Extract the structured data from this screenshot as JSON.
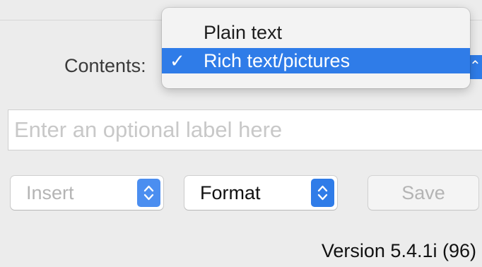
{
  "contents": {
    "label": "Contents:",
    "menu": {
      "options": [
        "Plain text",
        "Rich text/pictures"
      ],
      "selected_index": 1,
      "check_mark": "✓"
    }
  },
  "label_field": {
    "placeholder": "Enter an optional label here",
    "value": ""
  },
  "controls": {
    "insert_label": "Insert",
    "format_label": "Format",
    "save_label": "Save"
  },
  "footer": {
    "version": "Version 5.4.1i (96)"
  },
  "colors": {
    "accent": "#2f7ce8",
    "background": "#ececec",
    "disabled_text": "#b4b4b4"
  }
}
